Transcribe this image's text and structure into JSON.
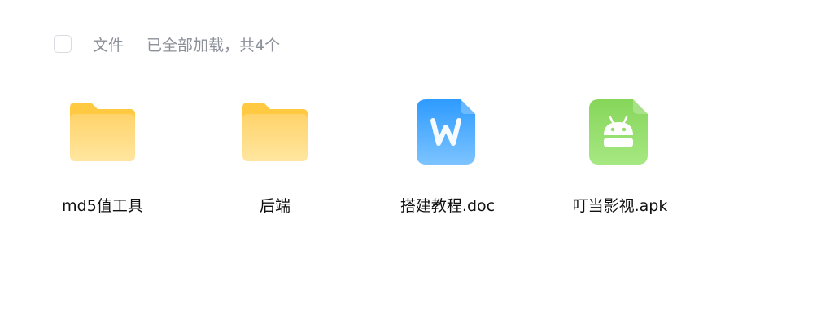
{
  "header": {
    "column_label": "文件",
    "status_text": "已全部加载，共4个"
  },
  "files": [
    {
      "name": "md5值工具",
      "type": "folder",
      "icon": "folder-icon"
    },
    {
      "name": "后端",
      "type": "folder",
      "icon": "folder-icon"
    },
    {
      "name": "搭建教程.doc",
      "type": "doc",
      "icon": "word-doc-icon"
    },
    {
      "name": "叮当影视.apk",
      "type": "apk",
      "icon": "android-apk-icon"
    }
  ],
  "colors": {
    "folder_top": "#ffc941",
    "folder_body": "#ffe08a",
    "doc_top": "#2e9bff",
    "doc_bottom": "#7cc3ff",
    "apk_top": "#86d65a",
    "apk_bottom": "#a6e882"
  }
}
